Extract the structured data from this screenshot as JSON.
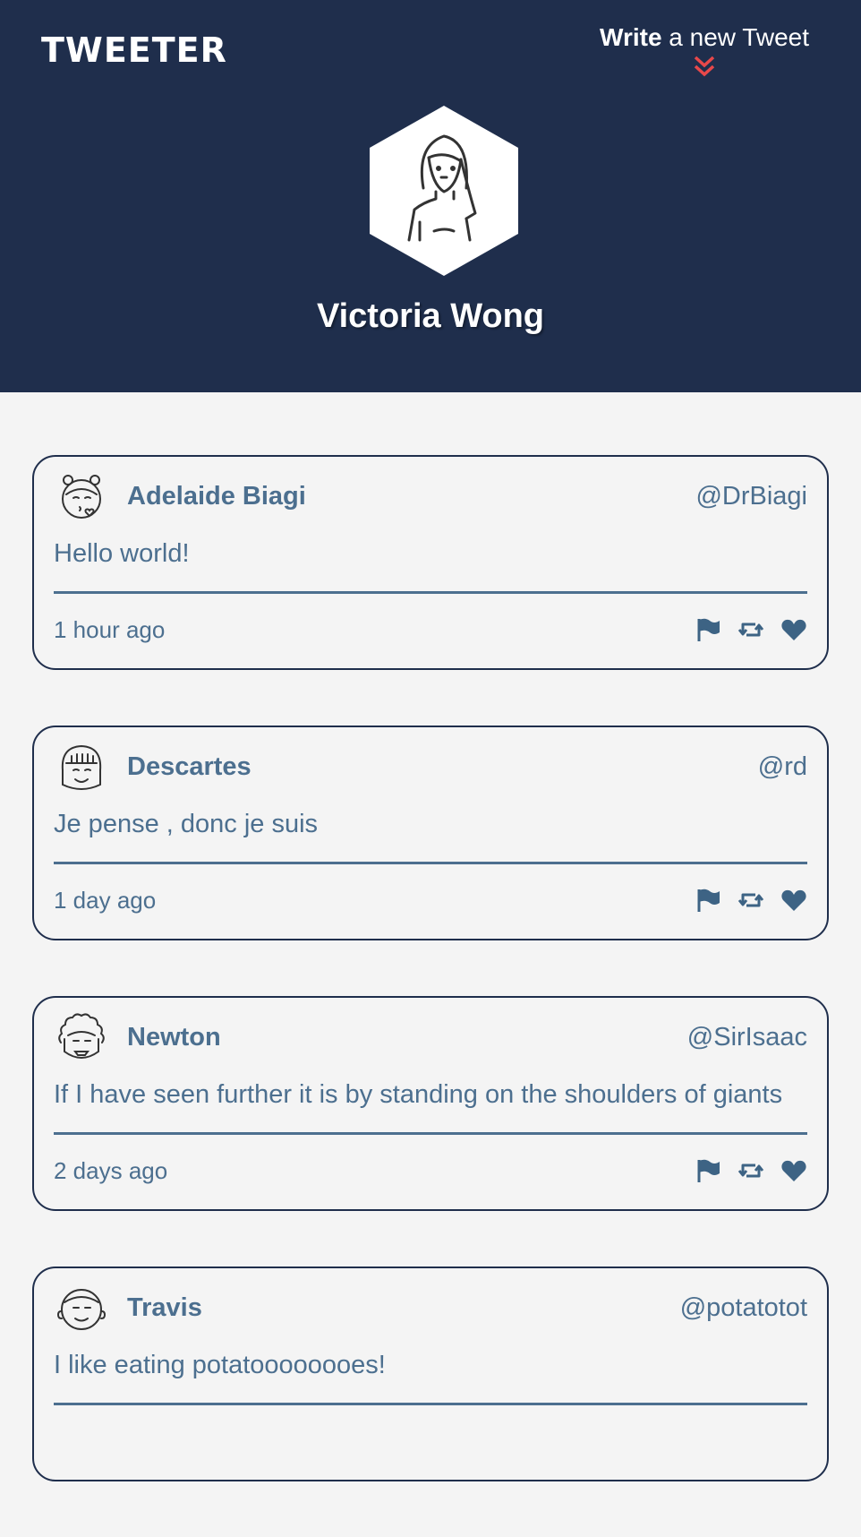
{
  "header": {
    "brand": "TWEETER",
    "compose_bold": "Write",
    "compose_rest": " a new Tweet",
    "profile_name": "Victoria Wong"
  },
  "colors": {
    "header_bg": "#1f2e4c",
    "text": "#4c6f8f",
    "accent": "#e8484a",
    "page_bg": "#f4f4f4"
  },
  "tweets": [
    {
      "name": "Adelaide Biagi",
      "handle": "@DrBiagi",
      "body": "Hello world!",
      "time": "1 hour ago",
      "avatar_icon": "girl-kiss-avatar-icon"
    },
    {
      "name": "Descartes",
      "handle": "@rd",
      "body": "Je pense , donc je suis",
      "time": "1 day ago",
      "avatar_icon": "bowl-cut-avatar-icon"
    },
    {
      "name": "Newton",
      "handle": "@SirIsaac",
      "body": "If I have seen further it is by standing on the shoulders of giants",
      "time": "2 days ago",
      "avatar_icon": "curly-wig-avatar-icon"
    },
    {
      "name": "Travis",
      "handle": "@potatotot",
      "body": "I like eating potatoooooooes!",
      "time": "",
      "avatar_icon": "bald-man-avatar-icon"
    }
  ],
  "actions": [
    "flag-icon",
    "retweet-icon",
    "heart-icon"
  ]
}
